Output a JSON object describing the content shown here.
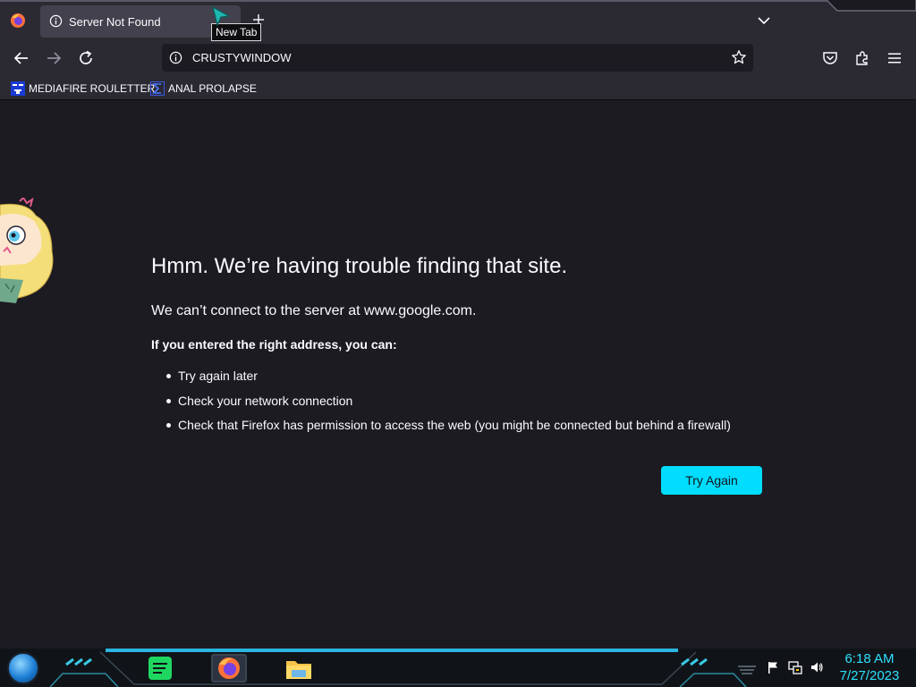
{
  "browser": {
    "tab": {
      "title": "Server Not Found"
    },
    "new_tab_tooltip": "New Tab",
    "address": "CRUSTYWINDOW",
    "bookmarks": [
      {
        "label": "MEDIAFIRE ROULETTER",
        "icon": "mediafire-icon"
      },
      {
        "label": "ANAL PROLAPSE",
        "icon": "sigma-icon"
      }
    ]
  },
  "error_page": {
    "title": "Hmm. We’re having trouble finding that site.",
    "subtitle": "We can’t connect to the server at www.google.com.",
    "hint": "If you entered the right address, you can:",
    "suggestions": [
      "Try again later",
      "Check your network connection",
      "Check that Firefox has permission to access the web (you might be connected but behind a firewall)"
    ],
    "button_label": "Try Again"
  },
  "taskbar": {
    "apps": [
      "spotify-icon",
      "firefox-icon",
      "file-explorer-icon"
    ],
    "clock": {
      "time": "6:18 AM",
      "date": "7/27/2023"
    }
  },
  "colors": {
    "accent": "#00ddff",
    "clock": "#2ee0ff",
    "background": "#1c1b22",
    "toolbar": "#2b2a33"
  }
}
